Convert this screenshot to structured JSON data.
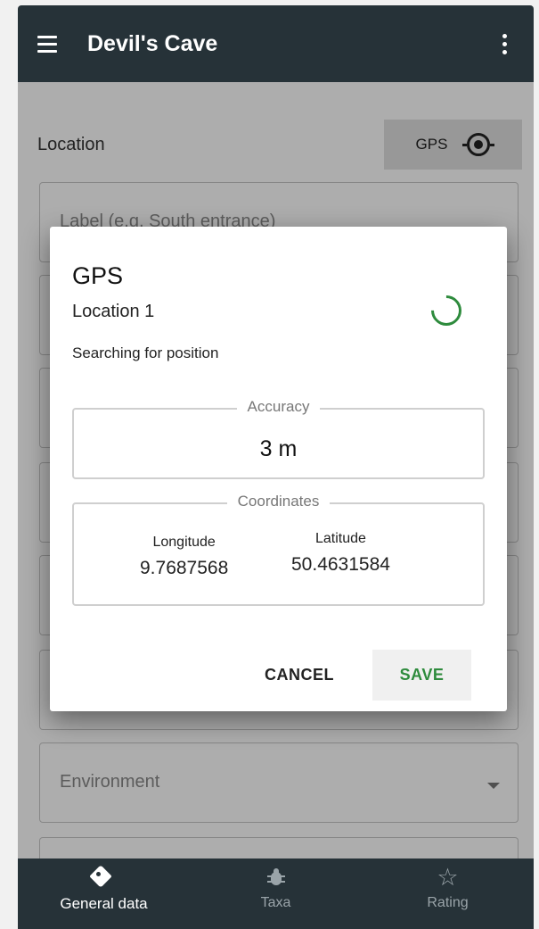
{
  "app_bar": {
    "title": "Devil's Cave"
  },
  "form": {
    "location_label": "Location",
    "gps_button_label": "GPS",
    "label_placeholder": "Label (e.g. South entrance)",
    "environment_placeholder": "Environment"
  },
  "dialog": {
    "title": "GPS",
    "subtitle": "Location 1",
    "status": "Searching for position",
    "accuracy": {
      "legend": "Accuracy",
      "value": "3 m"
    },
    "coordinates": {
      "legend": "Coordinates",
      "longitude_label": "Longitude",
      "longitude_value": "9.7687568",
      "latitude_label": "Latitude",
      "latitude_value": "50.4631584"
    },
    "cancel_label": "CANCEL",
    "save_label": "SAVE"
  },
  "bottom_nav": {
    "items": [
      {
        "label": "General data",
        "icon": "tag-icon",
        "active": true
      },
      {
        "label": "Taxa",
        "icon": "bug-icon",
        "active": false
      },
      {
        "label": "Rating",
        "icon": "star-icon",
        "active": false
      }
    ]
  },
  "colors": {
    "app_bar": "#263238",
    "accent_green": "#2e8b3d",
    "scrim": "rgba(0,0,0,0.32)"
  }
}
